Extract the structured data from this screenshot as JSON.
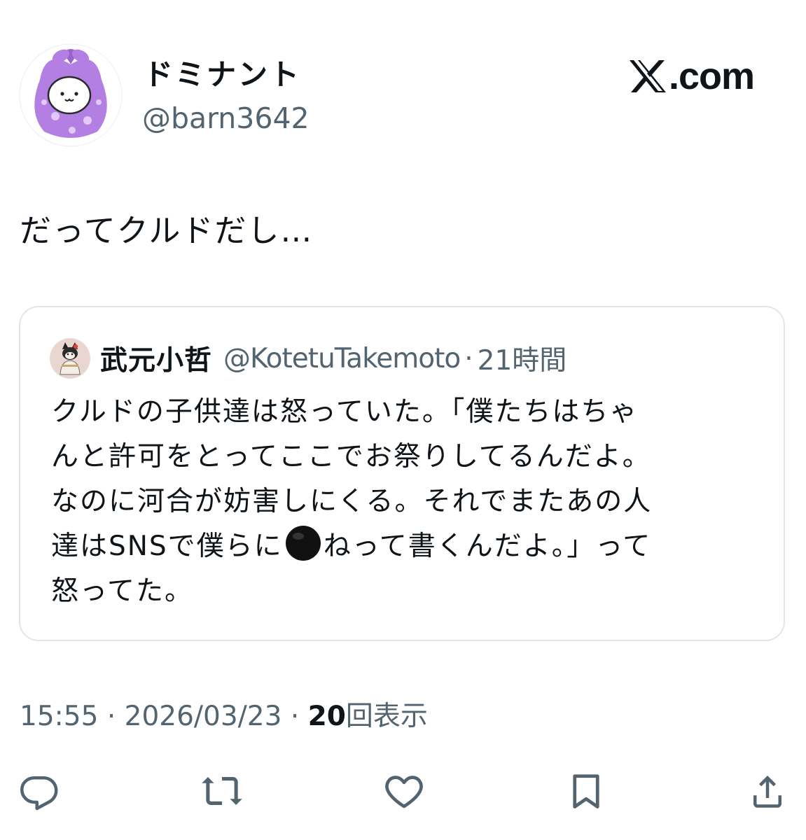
{
  "author": {
    "display_name": "ドミナント",
    "handle": "@barn3642",
    "avatar_icon": "furoshiki-mascot-avatar"
  },
  "brand": {
    "logo_icon": "x-logo-icon",
    "label": ".com"
  },
  "tweet": {
    "text": "だってクルドだし…"
  },
  "quoted": {
    "display_name": "武元小哲",
    "handle": "@KotetuTakemoto",
    "separator": "·",
    "time": "21時間",
    "avatar_icon": "cat-mascot-avatar",
    "body_lines": [
      "クルドの子供達は怒っていた。「僕たちはちゃ",
      "んと許可をとってここでお祭りしてるんだよ。",
      "なのに河合が妨害しにくる。それでまたあの人",
      "達はSNSで僕らに",
      "ねって書くんだよ。」って",
      "怒ってた。"
    ],
    "emoji_icon": "black-circle-icon"
  },
  "meta": {
    "time": "15:55",
    "separator": "·",
    "date": "2026/03/23",
    "views_count": "20",
    "views_label": "回表示"
  },
  "actions": [
    {
      "name": "reply",
      "icon": "reply-icon"
    },
    {
      "name": "repost",
      "icon": "repost-icon"
    },
    {
      "name": "like",
      "icon": "like-icon"
    },
    {
      "name": "bookmark",
      "icon": "bookmark-icon"
    },
    {
      "name": "share",
      "icon": "share-icon"
    }
  ],
  "colors": {
    "text": "#0f1419",
    "secondary": "#536471",
    "border": "#e1e6ea",
    "avatar_purple": "#b37fe3"
  }
}
